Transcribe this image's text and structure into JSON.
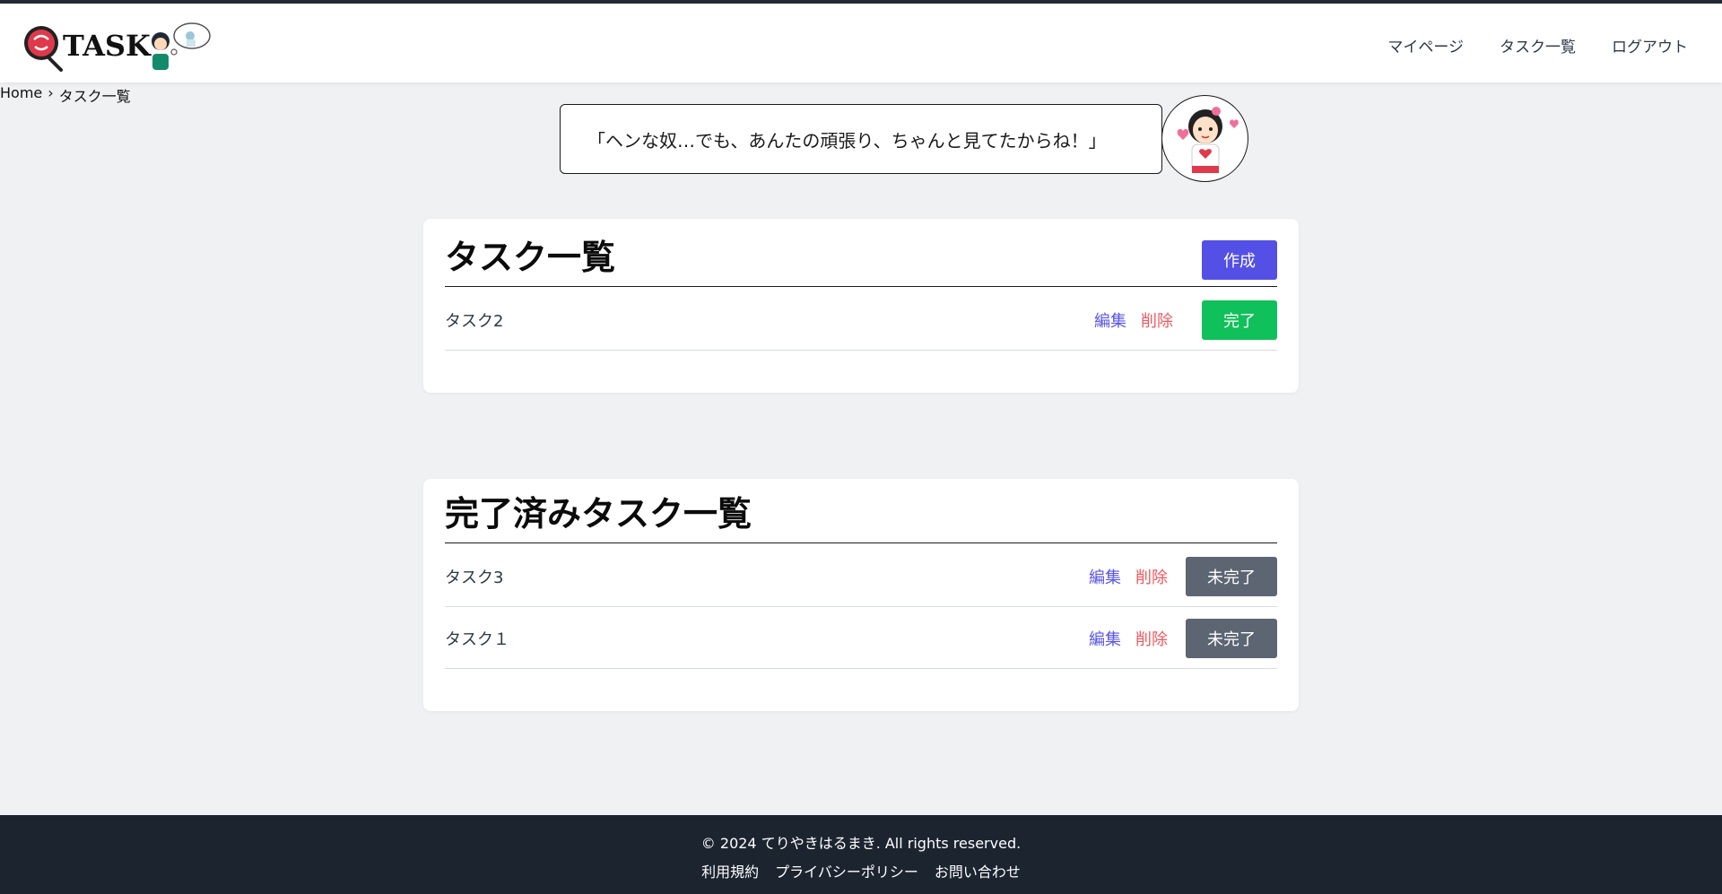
{
  "header": {
    "logo_text": "TASK",
    "nav": [
      "マイページ",
      "タスク一覧",
      "ログアウト"
    ]
  },
  "breadcrumb": {
    "home": "Home",
    "sep": "›",
    "current": "タスク一覧"
  },
  "speech": {
    "text": "「ヘンな奴…でも、あんたの頑張り、ちゃんと見てたからね！」"
  },
  "tasks": {
    "title": "タスク一覧",
    "create_label": "作成",
    "items": [
      {
        "name": "タスク2",
        "edit": "編集",
        "delete": "削除",
        "action": "完了"
      }
    ]
  },
  "completed": {
    "title": "完了済みタスク一覧",
    "items": [
      {
        "name": "タスク3",
        "edit": "編集",
        "delete": "削除",
        "action": "未完了"
      },
      {
        "name": "タスク１",
        "edit": "編集",
        "delete": "削除",
        "action": "未完了"
      }
    ]
  },
  "footer": {
    "copyright": "© 2024 てりやきはるまき. All rights reserved.",
    "links": [
      "利用規約",
      "プライバシーポリシー",
      "お問い合わせ"
    ]
  },
  "colors": {
    "primary": "#5550e5",
    "success": "#10c05a",
    "danger": "#f0585e",
    "muted": "#5d6573",
    "footer_bg": "#1c2430"
  }
}
